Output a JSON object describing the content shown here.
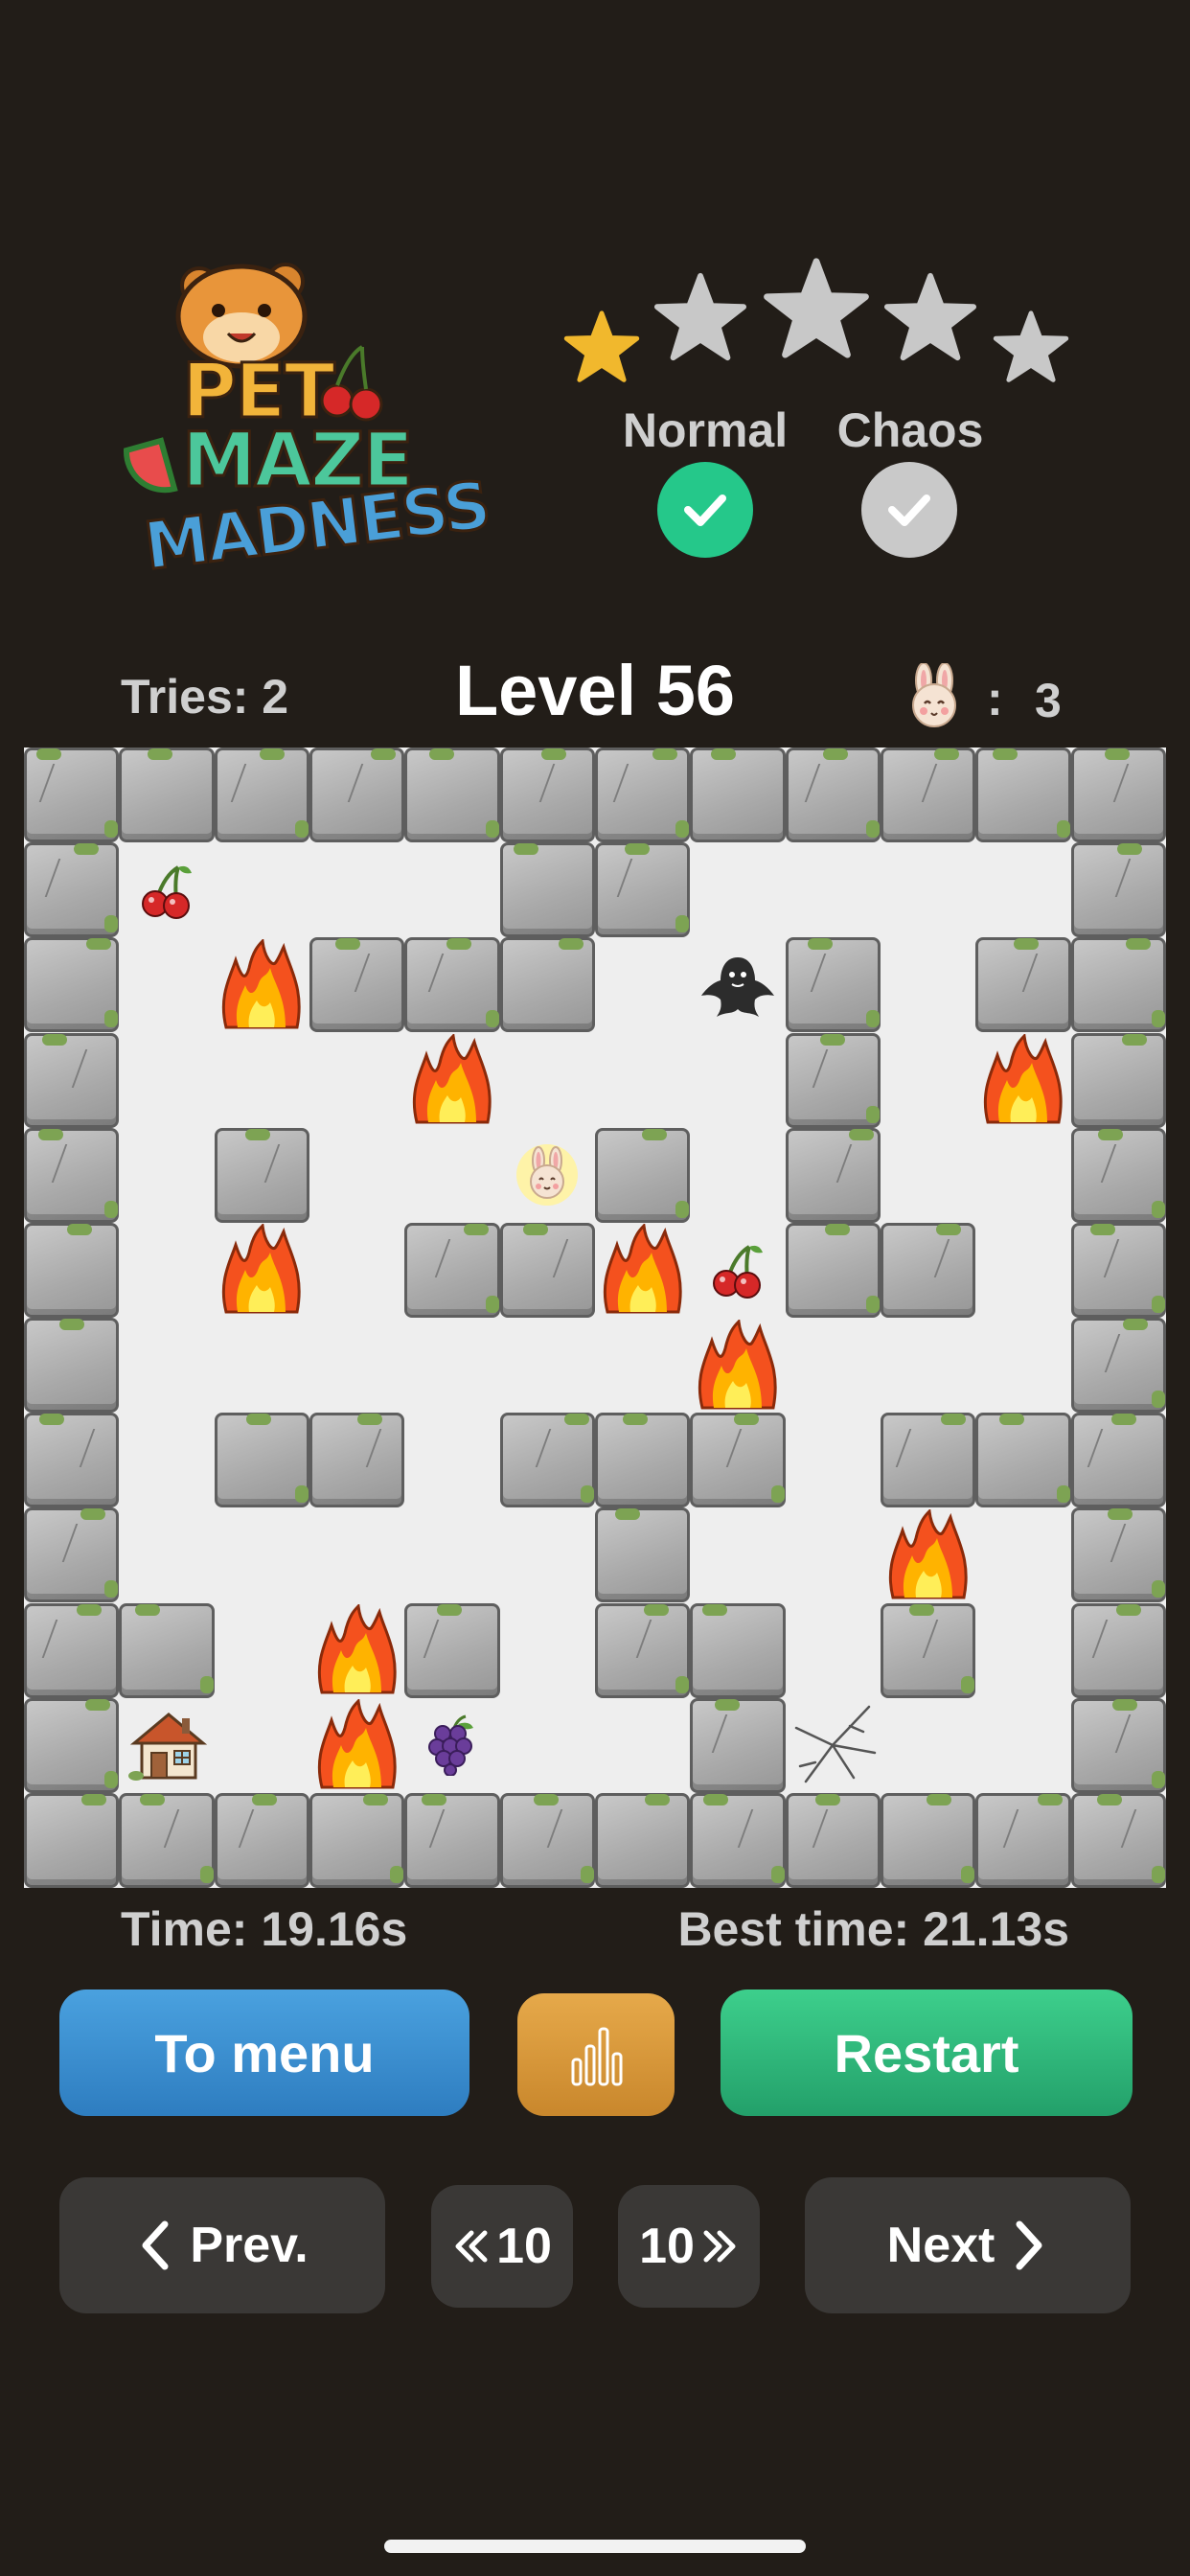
{
  "logo": {
    "line1": "PET",
    "line2": "MAZE",
    "line3": "MADNESS",
    "colors": {
      "pet": "#f2b43a",
      "maze": "#4cc79b",
      "madness": "#4a9fd8"
    }
  },
  "rating": {
    "stars_filled": 1,
    "stars_total": 5,
    "filled_color": "#f1b82d",
    "empty_color": "#c8c8c8"
  },
  "modes": [
    {
      "label": "Normal",
      "completed": true,
      "color": "#25c88a"
    },
    {
      "label": "Chaos",
      "completed": true,
      "color": "#c9c9c9"
    }
  ],
  "status": {
    "tries": "Tries: 2",
    "level": "Level 56",
    "lives_colon": ":",
    "lives": "3",
    "lives_icon": "bunny-face-icon"
  },
  "board": {
    "columns": 12,
    "rows": 12,
    "walls": [
      [
        0,
        0
      ],
      [
        1,
        0
      ],
      [
        2,
        0
      ],
      [
        3,
        0
      ],
      [
        4,
        0
      ],
      [
        5,
        0
      ],
      [
        6,
        0
      ],
      [
        7,
        0
      ],
      [
        8,
        0
      ],
      [
        9,
        0
      ],
      [
        10,
        0
      ],
      [
        11,
        0
      ],
      [
        0,
        1
      ],
      [
        5,
        1
      ],
      [
        6,
        1
      ],
      [
        11,
        1
      ],
      [
        0,
        2
      ],
      [
        3,
        2
      ],
      [
        4,
        2
      ],
      [
        5,
        2
      ],
      [
        8,
        2
      ],
      [
        10,
        2
      ],
      [
        11,
        2
      ],
      [
        0,
        3
      ],
      [
        8,
        3
      ],
      [
        11,
        3
      ],
      [
        0,
        4
      ],
      [
        2,
        4
      ],
      [
        6,
        4
      ],
      [
        8,
        4
      ],
      [
        11,
        4
      ],
      [
        0,
        5
      ],
      [
        4,
        5
      ],
      [
        5,
        5
      ],
      [
        8,
        5
      ],
      [
        9,
        5
      ],
      [
        11,
        5
      ],
      [
        0,
        6
      ],
      [
        11,
        6
      ],
      [
        0,
        7
      ],
      [
        2,
        7
      ],
      [
        3,
        7
      ],
      [
        5,
        7
      ],
      [
        6,
        7
      ],
      [
        7,
        7
      ],
      [
        9,
        7
      ],
      [
        10,
        7
      ],
      [
        11,
        7
      ],
      [
        0,
        8
      ],
      [
        6,
        8
      ],
      [
        11,
        8
      ],
      [
        0,
        9
      ],
      [
        1,
        9
      ],
      [
        4,
        9
      ],
      [
        6,
        9
      ],
      [
        7,
        9
      ],
      [
        9,
        9
      ],
      [
        11,
        9
      ],
      [
        0,
        10
      ],
      [
        7,
        10
      ],
      [
        11,
        10
      ],
      [
        0,
        11
      ],
      [
        1,
        11
      ],
      [
        2,
        11
      ],
      [
        3,
        11
      ],
      [
        4,
        11
      ],
      [
        5,
        11
      ],
      [
        6,
        11
      ],
      [
        7,
        11
      ],
      [
        8,
        11
      ],
      [
        9,
        11
      ],
      [
        10,
        11
      ],
      [
        11,
        11
      ]
    ],
    "fires": [
      [
        2,
        2
      ],
      [
        4,
        3
      ],
      [
        10,
        3
      ],
      [
        2,
        5
      ],
      [
        6,
        5
      ],
      [
        7,
        6
      ],
      [
        9,
        8
      ],
      [
        3,
        9
      ],
      [
        3,
        10
      ]
    ],
    "items": [
      {
        "type": "cherry",
        "icon": "cherry-icon",
        "cell": [
          1,
          1
        ]
      },
      {
        "type": "ghost",
        "icon": "ghost-icon",
        "cell": [
          7,
          2
        ]
      },
      {
        "type": "player",
        "icon": "bunny-player-icon",
        "cell": [
          5,
          4
        ]
      },
      {
        "type": "cherry",
        "icon": "cherry-icon",
        "cell": [
          7,
          5
        ]
      },
      {
        "type": "home",
        "icon": "house-icon",
        "cell": [
          1,
          10
        ]
      },
      {
        "type": "grapes",
        "icon": "grapes-icon",
        "cell": [
          4,
          10
        ]
      },
      {
        "type": "crack",
        "icon": "floor-crack-icon",
        "cell": [
          8,
          10
        ]
      }
    ],
    "colors": {
      "floor": "#eeeeee",
      "wall": "#a9a9a9",
      "moss": "#7da353"
    }
  },
  "timing": {
    "time": "Time: 19.16s",
    "best": "Best time: 21.13s"
  },
  "buttons": {
    "menu": "To menu",
    "stats_icon": "bar-chart-icon",
    "restart": "Restart",
    "prev": "Prev.",
    "back10": "10",
    "fwd10": "10",
    "next": "Next"
  }
}
